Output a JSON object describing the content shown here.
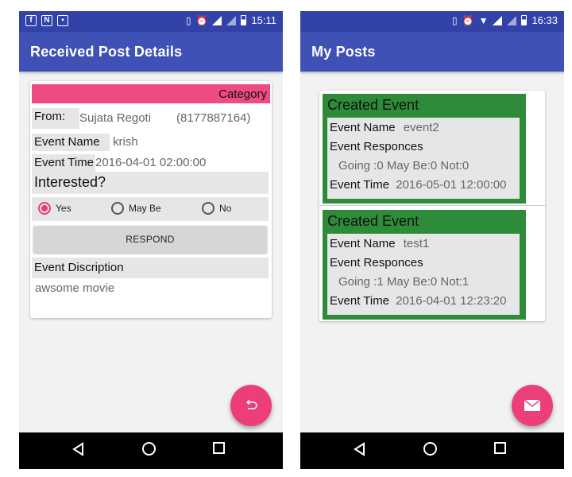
{
  "left_screen": {
    "status_bar": {
      "time": "15:11"
    },
    "app_bar": {
      "title": "Received Post Details"
    },
    "card": {
      "category": "Category",
      "from_label": "From:",
      "from_name": "Sujata Regoti",
      "from_phone": "(8177887164)",
      "event_name_label": "Event Name",
      "event_name_value": "krish",
      "event_time_label": "Event Time",
      "event_time_value": "2016-04-01 02:00:00",
      "interested_label": "Interested?",
      "options": [
        {
          "label": "Yes",
          "checked": true
        },
        {
          "label": "May Be",
          "checked": false
        },
        {
          "label": "No",
          "checked": false
        }
      ],
      "respond_label": "RESPOND",
      "description_label": "Event Discription",
      "description_value": "awsome movie"
    },
    "fab_icon": "undo-icon"
  },
  "right_screen": {
    "status_bar": {
      "time": "16:33"
    },
    "app_bar": {
      "title": "My Posts"
    },
    "posts": [
      {
        "header": "Created Event",
        "event_name_label": "Event Name",
        "event_name_value": "event2",
        "responses_label": "Event Responces",
        "counts": "Going :0  May Be:0  Not:0",
        "event_time_label": "Event Time",
        "event_time_value": "2016-05-01 12:00:00"
      },
      {
        "header": "Created Event",
        "event_name_label": "Event Name",
        "event_name_value": "test1",
        "responses_label": "Event Responces",
        "counts": "Going :1  May Be:0  Not:1",
        "event_time_label": "Event Time",
        "event_time_value": "2016-04-01 12:23:20"
      }
    ],
    "fab_icon": "mail-icon"
  },
  "colors": {
    "app_bar": "#3f51b5",
    "status_bar": "#3342a8",
    "accent": "#ec3f7a",
    "category_bar": "#f04a83",
    "post_card": "#2e8b3a"
  }
}
